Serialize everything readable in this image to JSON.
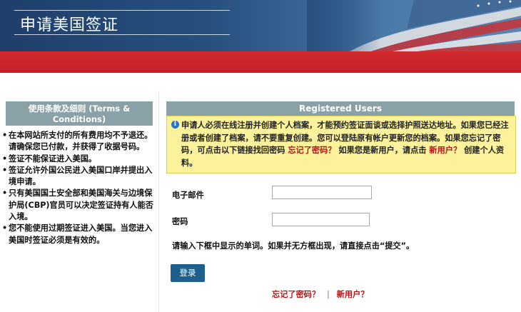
{
  "header": {
    "title": "申请美国签证"
  },
  "left": {
    "box_title": "使用条款及细则 (Terms & Conditions)",
    "terms": [
      "在本网站所支付的所有费用均不予退还。请确保您已付款，并获得了收据号码。",
      "签证不能保证进入美国。",
      "签证允许外国公民进入美国口岸并提出入境申请。",
      "只有美国国土安全部和美国海关与边境保护局(CBP)官员可以决定签证持有人能否入境。",
      "您不能使用过期签证进入美国。当您进入美国时签证必须是有效的。"
    ]
  },
  "panel": {
    "header": "Registered Users",
    "notice": {
      "text_before": "申请人必须在线注册并创建个人档案，才能预约签证面谈或选择护照送达地址。如果您已经注册或者创建了档案，请不要重复创建。您可以登陆原有帐户更新您的档案。如果您忘记了密码，可点击以下链接找回密码",
      "forgot_link": "忘记了密码？",
      "text_middle": "如果您是新用户，请点击",
      "new_user_link": "新用户？",
      "text_after": "创建个人资料。"
    },
    "email_label": "电子邮件",
    "email_value": "",
    "password_label": "密码",
    "password_value": "",
    "hint": "请输入下框中显示的单词。如果并无方框出现，请直接点击“提交”。",
    "login_button": "登录",
    "bottom": {
      "forgot": "忘记了密码？",
      "separator": "|",
      "new_user": "新用户？"
    }
  },
  "colors": {
    "header_blue": "#27507f",
    "red_band": "#c71f26",
    "section_header": "#8aa1a8",
    "notice_bg": "#fbf29b",
    "link_red": "#b21818",
    "button_blue": "#1f5f8b"
  }
}
